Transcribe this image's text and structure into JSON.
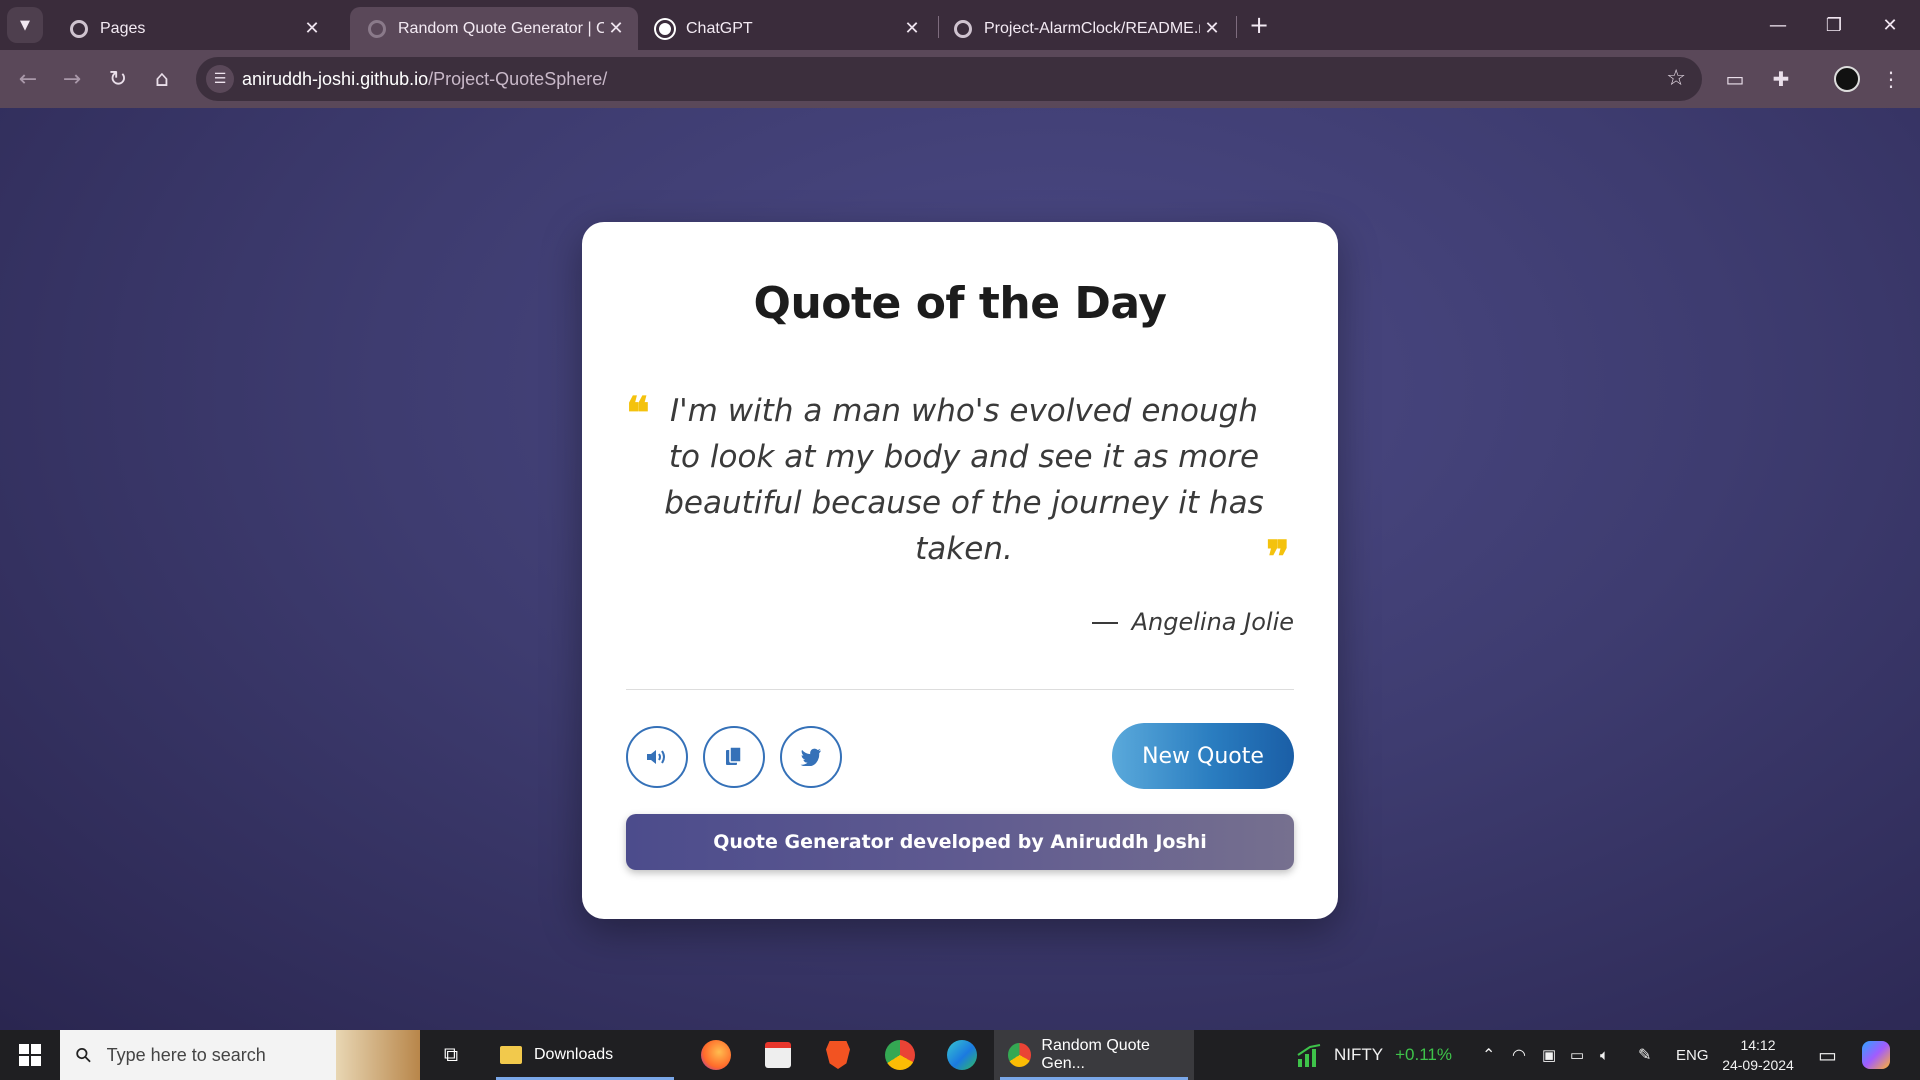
{
  "browser": {
    "tabs": [
      {
        "title": "Pages",
        "favicon": "github-icon",
        "active": false
      },
      {
        "title": "Random Quote Generator | Coc",
        "favicon": "loading-icon",
        "active": true
      },
      {
        "title": "ChatGPT",
        "favicon": "chatgpt-icon",
        "active": false
      },
      {
        "title": "Project-AlarmClock/README.m",
        "favicon": "github-icon",
        "active": false
      }
    ],
    "url_host": "aniruddh-joshi.github.io",
    "url_path": "/Project-QuoteSphere/"
  },
  "page": {
    "title": "Quote of the Day",
    "quote_open_mark": "❝",
    "quote_close_mark": "❞",
    "quote": "I'm with a man who's evolved enough to look at my body and see it as more beautiful because of the journey it has taken.",
    "author": "Angelina Jolie",
    "buttons": {
      "speak": "volume-icon",
      "copy": "copy-icon",
      "tweet": "twitter-icon",
      "new_quote": "New Quote"
    },
    "credit": "Quote Generator developed by Aniruddh Joshi"
  },
  "taskbar": {
    "search_placeholder": "Type here to search",
    "downloads_label": "Downloads",
    "active_app_label": "Random Quote Gen...",
    "ticker_name": "NIFTY",
    "ticker_change": "+0.11%",
    "language": "ENG",
    "time": "14:12",
    "date": "24-09-2024"
  },
  "colors": {
    "accent_blue": "#3571b8",
    "quote_mark_yellow": "#f4c20d",
    "ticker_green": "#3ec34a"
  }
}
